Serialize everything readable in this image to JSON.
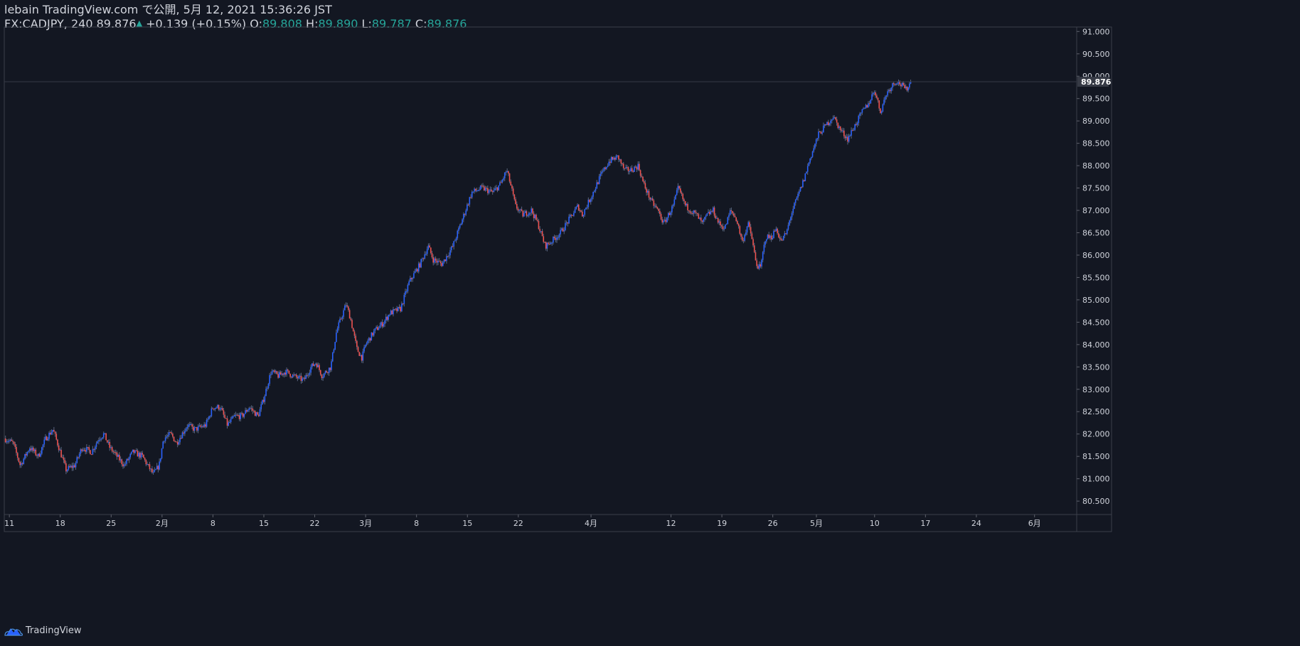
{
  "header": {
    "line1": "lebain TradingView.com で公開, 5月 12, 2021 15:36:26 JST",
    "symbol": "FX:CADJPY, 240",
    "last": "89.876",
    "change": "+0.139 (+0.15%)",
    "o_label": "O:",
    "o_value": "89.808",
    "h_label": "H:",
    "h_value": "89.890",
    "l_label": "L:",
    "l_value": "89.787",
    "c_label": "C:",
    "c_value": "89.876"
  },
  "footer": {
    "brand": "TradingView",
    "logo_icon": "tradingview-cloud-icon"
  },
  "colors": {
    "background": "#131722",
    "up": "#2962ff",
    "down": "#ef5350",
    "text": "#d1d4dc",
    "ohlc": "#26a69a",
    "price_label_bg": "#363a45"
  },
  "chart_data": {
    "type": "candlestick",
    "symbol": "FX:CADJPY",
    "interval": "240",
    "ylim": [
      80.2,
      91.1
    ],
    "y_ticks": [
      "91.000",
      "90.500",
      "90.000",
      "89.500",
      "89.000",
      "88.500",
      "88.000",
      "87.500",
      "87.000",
      "86.500",
      "86.000",
      "85.500",
      "85.000",
      "84.500",
      "84.000",
      "83.500",
      "83.000",
      "82.500",
      "82.000",
      "81.500",
      "81.000",
      "80.500"
    ],
    "current_price": "89.876",
    "x_ticks": [
      {
        "label": "11",
        "t": 0
      },
      {
        "label": "18",
        "t": 7
      },
      {
        "label": "25",
        "t": 14
      },
      {
        "label": "2月",
        "t": 21
      },
      {
        "label": "8",
        "t": 28
      },
      {
        "label": "15",
        "t": 35
      },
      {
        "label": "22",
        "t": 42
      },
      {
        "label": "3月",
        "t": 49
      },
      {
        "label": "8",
        "t": 56
      },
      {
        "label": "15",
        "t": 63
      },
      {
        "label": "22",
        "t": 70
      },
      {
        "label": "4月",
        "t": 80
      },
      {
        "label": "12",
        "t": 91
      },
      {
        "label": "19",
        "t": 98
      },
      {
        "label": "26",
        "t": 105
      },
      {
        "label": "5月",
        "t": 111
      },
      {
        "label": "10",
        "t": 119
      },
      {
        "label": "17",
        "t": 126
      },
      {
        "label": "24",
        "t": 133
      },
      {
        "label": "6月",
        "t": 141
      }
    ],
    "x_range_days": [
      -0.7,
      146.8
    ],
    "close_path": [
      {
        "t": -0.7,
        "c": 81.9
      },
      {
        "t": 0.5,
        "c": 81.8
      },
      {
        "t": 1.5,
        "c": 81.3
      },
      {
        "t": 2.8,
        "c": 81.7
      },
      {
        "t": 4,
        "c": 81.5
      },
      {
        "t": 5,
        "c": 81.9
      },
      {
        "t": 6,
        "c": 82.1
      },
      {
        "t": 7,
        "c": 81.6
      },
      {
        "t": 7.8,
        "c": 81.2
      },
      {
        "t": 9,
        "c": 81.3
      },
      {
        "t": 10,
        "c": 81.7
      },
      {
        "t": 11.3,
        "c": 81.6
      },
      {
        "t": 12.3,
        "c": 81.9
      },
      {
        "t": 13,
        "c": 82.0
      },
      {
        "t": 13.8,
        "c": 81.7
      },
      {
        "t": 14.8,
        "c": 81.5
      },
      {
        "t": 15.8,
        "c": 81.3
      },
      {
        "t": 17,
        "c": 81.6
      },
      {
        "t": 18.3,
        "c": 81.5
      },
      {
        "t": 19,
        "c": 81.3
      },
      {
        "t": 19.8,
        "c": 81.1
      },
      {
        "t": 20.6,
        "c": 81.3
      },
      {
        "t": 21.2,
        "c": 81.9
      },
      {
        "t": 22.2,
        "c": 82.0
      },
      {
        "t": 23,
        "c": 81.8
      },
      {
        "t": 24.5,
        "c": 82.2
      },
      {
        "t": 25.5,
        "c": 82.1
      },
      {
        "t": 27,
        "c": 82.2
      },
      {
        "t": 28,
        "c": 82.6
      },
      {
        "t": 29,
        "c": 82.6
      },
      {
        "t": 30,
        "c": 82.2
      },
      {
        "t": 31,
        "c": 82.4
      },
      {
        "t": 32,
        "c": 82.4
      },
      {
        "t": 33,
        "c": 82.6
      },
      {
        "t": 34.2,
        "c": 82.4
      },
      {
        "t": 35,
        "c": 82.8
      },
      {
        "t": 36,
        "c": 83.4
      },
      {
        "t": 37,
        "c": 83.3
      },
      {
        "t": 38,
        "c": 83.4
      },
      {
        "t": 39,
        "c": 83.3
      },
      {
        "t": 40.5,
        "c": 83.2
      },
      {
        "t": 41.5,
        "c": 83.5
      },
      {
        "t": 42.2,
        "c": 83.6
      },
      {
        "t": 43,
        "c": 83.3
      },
      {
        "t": 44.2,
        "c": 83.5
      },
      {
        "t": 45,
        "c": 84.3
      },
      {
        "t": 46.3,
        "c": 84.9
      },
      {
        "t": 46.9,
        "c": 84.6
      },
      {
        "t": 47.8,
        "c": 83.9
      },
      {
        "t": 48.5,
        "c": 83.7
      },
      {
        "t": 49,
        "c": 84.0
      },
      {
        "t": 50.2,
        "c": 84.3
      },
      {
        "t": 51.5,
        "c": 84.5
      },
      {
        "t": 52.3,
        "c": 84.7
      },
      {
        "t": 53.8,
        "c": 84.8
      },
      {
        "t": 55,
        "c": 85.4
      },
      {
        "t": 56.5,
        "c": 85.8
      },
      {
        "t": 57.6,
        "c": 86.2
      },
      {
        "t": 58.3,
        "c": 85.9
      },
      {
        "t": 59.5,
        "c": 85.8
      },
      {
        "t": 61,
        "c": 86.2
      },
      {
        "t": 62.3,
        "c": 86.8
      },
      {
        "t": 63.6,
        "c": 87.4
      },
      {
        "t": 65,
        "c": 87.5
      },
      {
        "t": 66.5,
        "c": 87.4
      },
      {
        "t": 67.6,
        "c": 87.6
      },
      {
        "t": 68.4,
        "c": 87.9
      },
      {
        "t": 68.9,
        "c": 87.6
      },
      {
        "t": 69.6,
        "c": 87.1
      },
      {
        "t": 70.6,
        "c": 86.9
      },
      {
        "t": 71.8,
        "c": 87.0
      },
      {
        "t": 72.7,
        "c": 86.7
      },
      {
        "t": 73.7,
        "c": 86.2
      },
      {
        "t": 74.5,
        "c": 86.3
      },
      {
        "t": 75.8,
        "c": 86.5
      },
      {
        "t": 77,
        "c": 86.8
      },
      {
        "t": 78.2,
        "c": 87.1
      },
      {
        "t": 78.8,
        "c": 86.9
      },
      {
        "t": 80,
        "c": 87.3
      },
      {
        "t": 81.4,
        "c": 87.8
      },
      {
        "t": 82.5,
        "c": 88.1
      },
      {
        "t": 83.7,
        "c": 88.2
      },
      {
        "t": 84.6,
        "c": 87.9
      },
      {
        "t": 85.5,
        "c": 87.9
      },
      {
        "t": 86.5,
        "c": 88.0
      },
      {
        "t": 87.2,
        "c": 87.6
      },
      {
        "t": 88.3,
        "c": 87.2
      },
      {
        "t": 89.2,
        "c": 87.0
      },
      {
        "t": 90,
        "c": 86.7
      },
      {
        "t": 91.3,
        "c": 87.1
      },
      {
        "t": 92,
        "c": 87.5
      },
      {
        "t": 93,
        "c": 87.1
      },
      {
        "t": 94.5,
        "c": 86.9
      },
      {
        "t": 95.3,
        "c": 86.7
      },
      {
        "t": 96,
        "c": 86.9
      },
      {
        "t": 96.8,
        "c": 87.0
      },
      {
        "t": 97.6,
        "c": 86.7
      },
      {
        "t": 98.4,
        "c": 86.6
      },
      {
        "t": 99.2,
        "c": 87.0
      },
      {
        "t": 100,
        "c": 86.8
      },
      {
        "t": 100.8,
        "c": 86.3
      },
      {
        "t": 101.6,
        "c": 86.7
      },
      {
        "t": 102.1,
        "c": 86.4
      },
      {
        "t": 102.7,
        "c": 85.8
      },
      {
        "t": 103.3,
        "c": 85.7
      },
      {
        "t": 104,
        "c": 86.4
      },
      {
        "t": 104.8,
        "c": 86.4
      },
      {
        "t": 105.5,
        "c": 86.6
      },
      {
        "t": 106.1,
        "c": 86.3
      },
      {
        "t": 106.9,
        "c": 86.5
      },
      {
        "t": 107.5,
        "c": 86.9
      },
      {
        "t": 108.4,
        "c": 87.3
      },
      {
        "t": 109.3,
        "c": 87.7
      },
      {
        "t": 110.2,
        "c": 88.2
      },
      {
        "t": 111.3,
        "c": 88.7
      },
      {
        "t": 112.3,
        "c": 88.9
      },
      {
        "t": 113.3,
        "c": 89.1
      },
      {
        "t": 114.3,
        "c": 88.8
      },
      {
        "t": 115.3,
        "c": 88.6
      },
      {
        "t": 116.3,
        "c": 88.9
      },
      {
        "t": 117.3,
        "c": 89.2
      },
      {
        "t": 118.2,
        "c": 89.4
      },
      {
        "t": 119,
        "c": 89.7
      },
      {
        "t": 119.8,
        "c": 89.2
      },
      {
        "t": 120.6,
        "c": 89.6
      },
      {
        "t": 121.4,
        "c": 89.8
      },
      {
        "t": 122,
        "c": 89.9
      },
      {
        "t": 122.7,
        "c": 89.8
      },
      {
        "t": 123.3,
        "c": 89.7
      },
      {
        "t": 124,
        "c": 89.876
      }
    ]
  }
}
